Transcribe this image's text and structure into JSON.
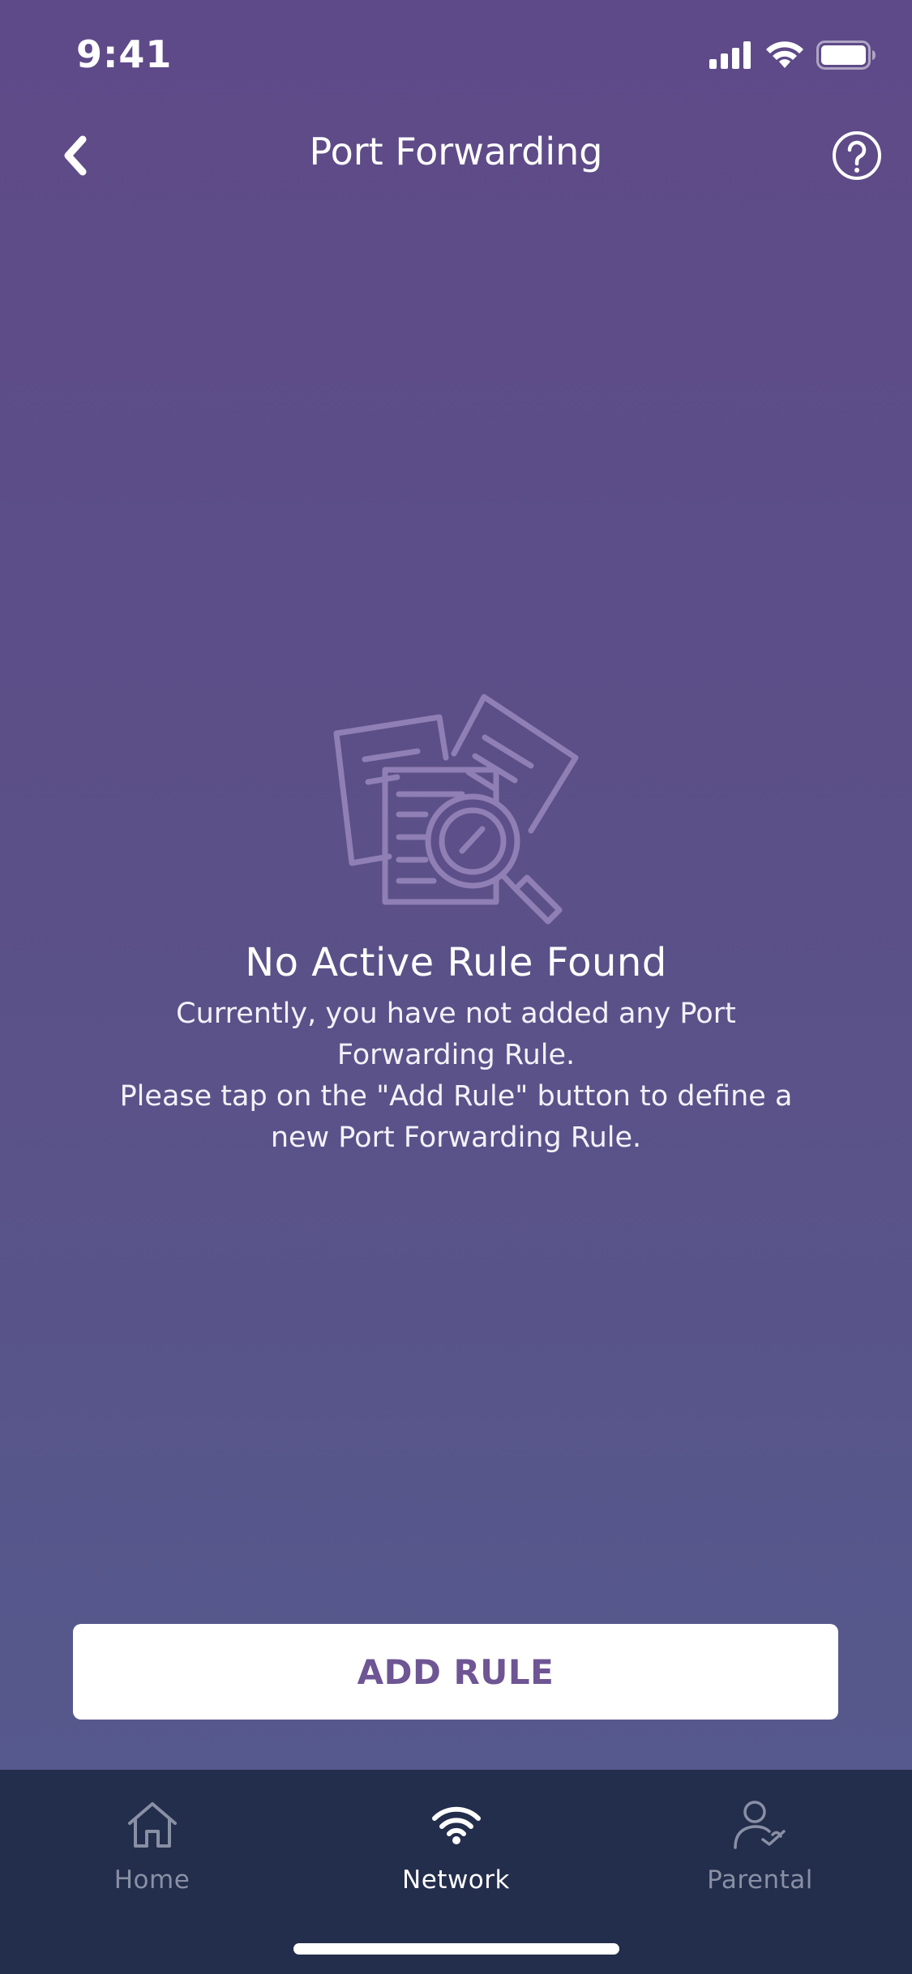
{
  "status_bar": {
    "time": "9:41",
    "icons": [
      "signal-icon",
      "wifi-icon",
      "battery-icon"
    ]
  },
  "header": {
    "title": "Port Forwarding",
    "back_icon": "chevron-left-icon",
    "help_icon": "help-circle-icon"
  },
  "empty_state": {
    "illustration": "documents-search-icon",
    "title": "No Active Rule Found",
    "message": "Currently, you have not added any Port Forwarding Rule.\nPlease tap on the \"Add Rule\" button to define a new Port Forwarding Rule."
  },
  "actions": {
    "add_rule_label": "ADD RULE"
  },
  "tab_bar": {
    "tabs": [
      {
        "label": "Home",
        "icon": "home-icon",
        "active": false
      },
      {
        "label": "Network",
        "icon": "wifi-icon",
        "active": true
      },
      {
        "label": "Parental",
        "icon": "parental-icon",
        "active": false
      }
    ]
  },
  "colors": {
    "background_top": "#5e4a88",
    "background_bottom": "#545b8e",
    "button_text": "#6e5593",
    "tab_bar": "#232d4c",
    "tab_inactive": "#8990a4"
  }
}
